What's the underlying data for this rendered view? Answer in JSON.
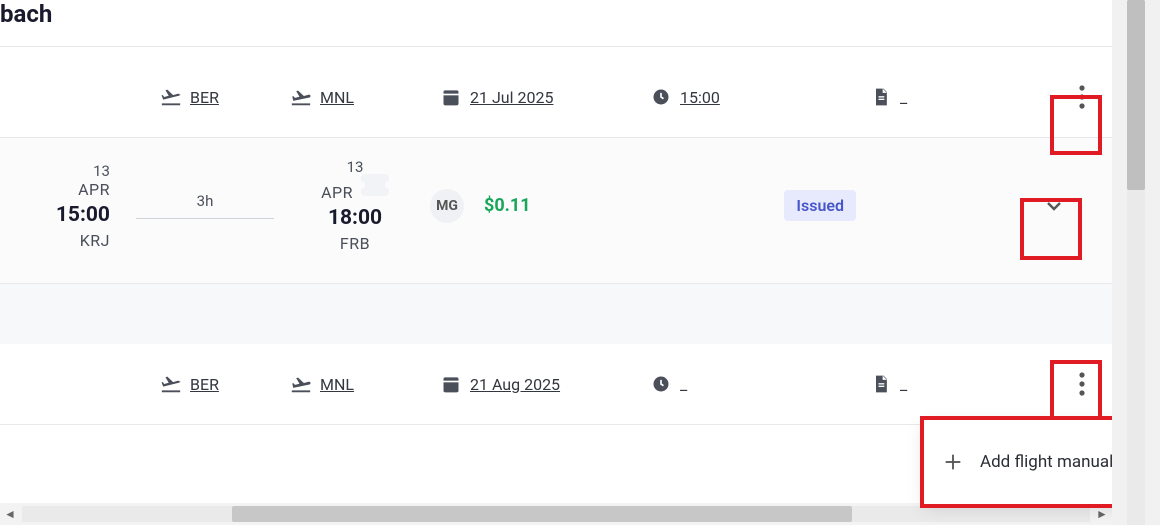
{
  "header_fragment": "bach",
  "rows": [
    {
      "seg": "",
      "dep": "BER",
      "arr": "MNL",
      "date": "21 Jul 2025",
      "time": "15:00",
      "doc": "_"
    },
    {
      "seg": "",
      "dep": "BER",
      "arr": "MNL",
      "date": "21 Aug 2025",
      "time": "_",
      "doc": "_"
    }
  ],
  "detail": {
    "dep_day": "13",
    "dep_month": "APR",
    "dep_time": "15:00",
    "dep_code": "KRJ",
    "duration": "3h",
    "arr_day": "13",
    "arr_month": "APR",
    "arr_time": "18:00",
    "arr_code": "FRB",
    "carrier": "MG",
    "price": "$0.11",
    "status": "Issued"
  },
  "menu": {
    "add_flight": "Add flight manually"
  }
}
